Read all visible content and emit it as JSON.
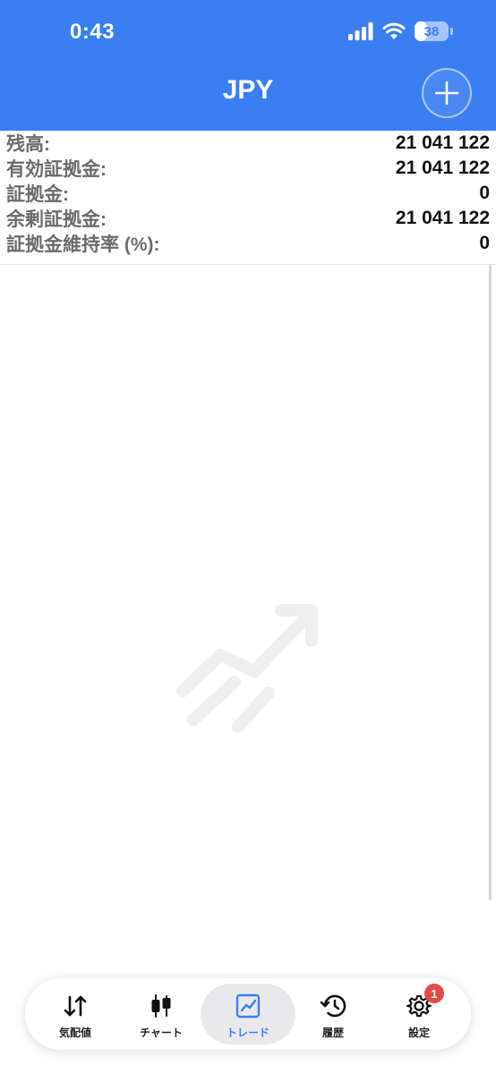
{
  "status_bar": {
    "time": "0:43",
    "battery_level": "38"
  },
  "header": {
    "title": "JPY",
    "add_icon": "plus-icon"
  },
  "account": {
    "rows": [
      {
        "label": "残高:",
        "value": "21 041 122"
      },
      {
        "label": "有効証拠金:",
        "value": "21 041 122"
      },
      {
        "label": "証拠金:",
        "value": "0"
      },
      {
        "label": "余剰証拠金:",
        "value": "21 041 122"
      },
      {
        "label": "証拠金維持率 (%):",
        "value": "0"
      }
    ]
  },
  "empty_state": {
    "icon": "trend-up-icon"
  },
  "tabbar": {
    "items": [
      {
        "label": "気配値",
        "icon": "quotes-icon"
      },
      {
        "label": "チャート",
        "icon": "candlestick-icon"
      },
      {
        "label": "トレード",
        "icon": "trade-chart-icon",
        "active": true
      },
      {
        "label": "履歴",
        "icon": "history-icon"
      },
      {
        "label": "設定",
        "icon": "gear-icon",
        "badge": "1"
      }
    ]
  },
  "colors": {
    "brand": "#3a7ef2",
    "badge": "#e64848",
    "label_gray": "#6b6b6b"
  }
}
